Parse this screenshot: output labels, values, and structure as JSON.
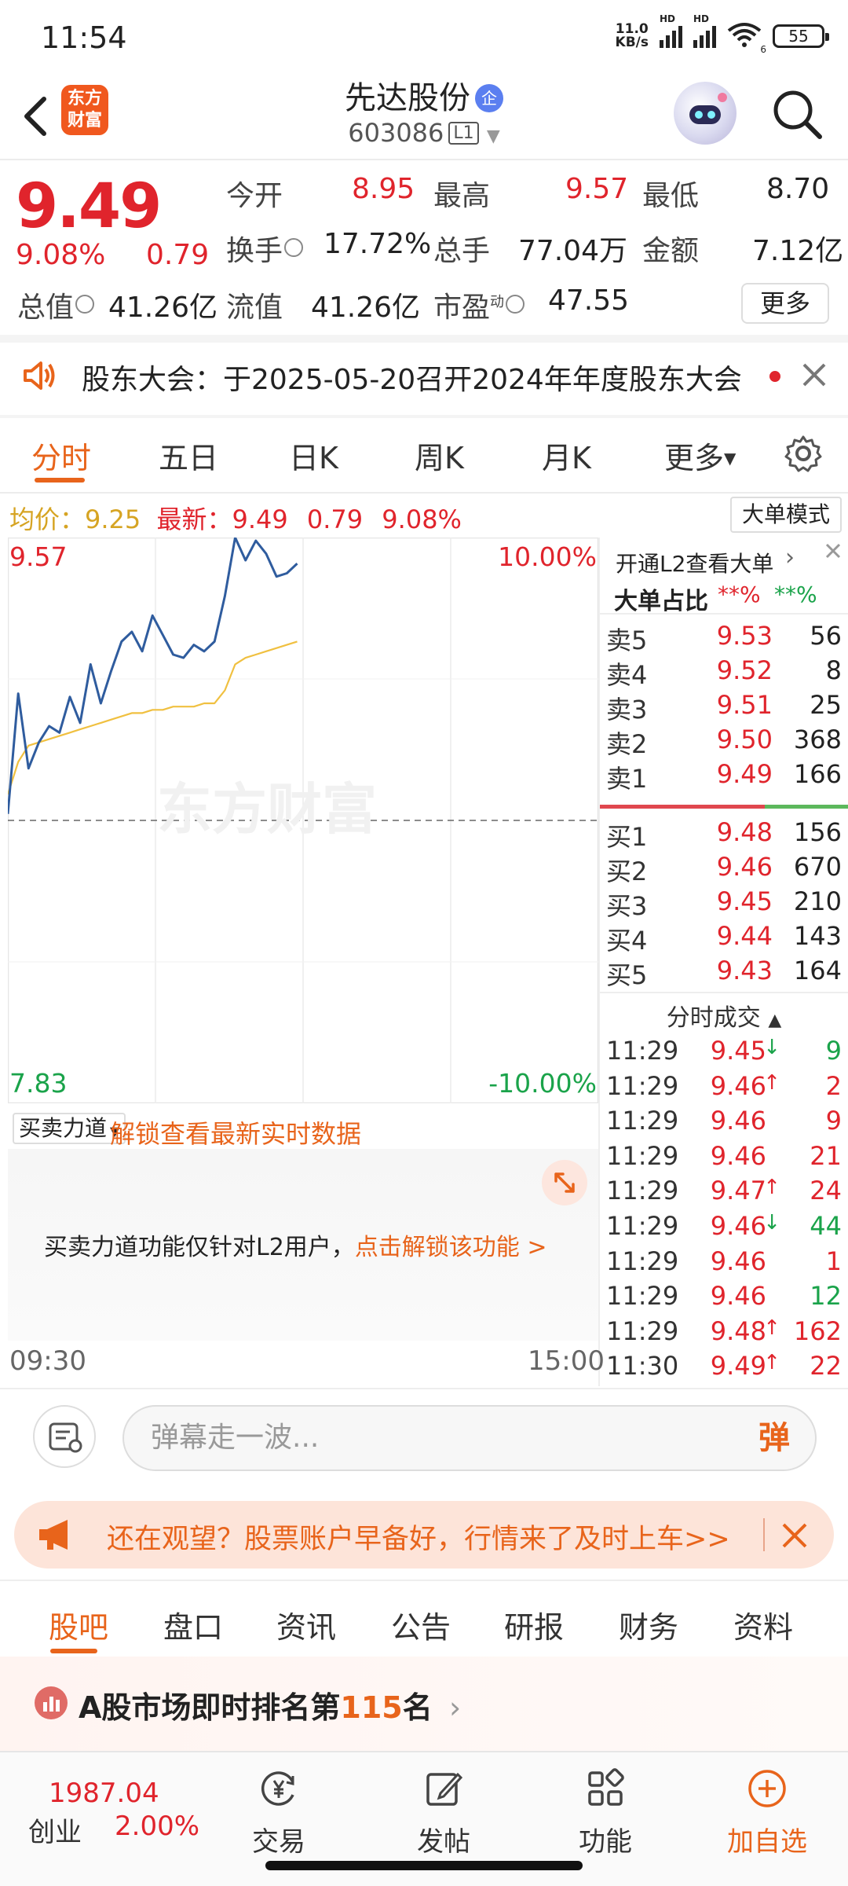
{
  "status_bar": {
    "time": "11:54",
    "net_speed_top": "11.0",
    "net_speed_bottom": "KB/s",
    "hd1": "HD",
    "hd2": "HD",
    "wifi_num": "6",
    "battery": "55"
  },
  "header": {
    "stock_name": "先达股份",
    "qi_badge": "企",
    "stock_code": "603086",
    "level_badge": "L1",
    "logo_line1": "东方",
    "logo_line2": "财富"
  },
  "quote": {
    "price": "9.49",
    "change_pct": "9.08%",
    "change": "0.79",
    "open_label": "今开",
    "open": "8.95",
    "high_label": "最高",
    "high": "9.57",
    "low_label": "最低",
    "low": "8.70",
    "turnover_label": "换手",
    "turnover": "17.72%",
    "volume_label": "总手",
    "volume": "77.04万",
    "amount_label": "金额",
    "amount": "7.12亿",
    "cap_label": "总值",
    "cap": "41.26亿",
    "float_label": "流值",
    "float_cap": "41.26亿",
    "pe_label": "市盈",
    "pe_sup": "动",
    "pe": "47.55",
    "more": "更多"
  },
  "notice": {
    "text": "股东大会：于2025-05-20召开2024年年度股东大会"
  },
  "chart_tabs": [
    "分时",
    "五日",
    "日K",
    "周K",
    "月K",
    "更多"
  ],
  "avg_line": {
    "avg_label": "均价：",
    "avg": "9.25",
    "latest_label": "最新：",
    "latest": "9.49",
    "chg": "0.79",
    "pct": "9.08%",
    "big_order_mode": "大单模式"
  },
  "chart_labels": {
    "top_price": "9.57",
    "top_pct": "10.00%",
    "bottom_price": "7.83",
    "bottom_pct": "-10.00%",
    "watermark": "东方财富",
    "start_time": "09:30",
    "end_time": "15:00"
  },
  "chart_data": {
    "type": "line",
    "x_range": [
      "09:30",
      "15:00"
    ],
    "ylim": [
      7.83,
      9.57
    ],
    "y_pct_range": [
      "-10.00%",
      "10.00%"
    ],
    "prev_close": 8.7,
    "series": [
      {
        "name": "价格",
        "color": "#2f5c9e",
        "values": [
          8.72,
          9.09,
          8.86,
          8.94,
          8.99,
          8.97,
          9.08,
          9.0,
          9.18,
          9.06,
          9.16,
          9.25,
          9.28,
          9.22,
          9.33,
          9.27,
          9.21,
          9.2,
          9.24,
          9.22,
          9.25,
          9.39,
          9.57,
          9.5,
          9.56,
          9.52,
          9.45,
          9.46,
          9.49
        ]
      },
      {
        "name": "均价",
        "color": "#f0c040",
        "values": [
          8.78,
          8.88,
          8.93,
          8.94,
          8.95,
          8.96,
          8.97,
          8.98,
          8.99,
          9.0,
          9.01,
          9.02,
          9.03,
          9.03,
          9.04,
          9.04,
          9.05,
          9.05,
          9.05,
          9.06,
          9.06,
          9.1,
          9.18,
          9.2,
          9.21,
          9.22,
          9.23,
          9.24,
          9.25
        ]
      }
    ]
  },
  "l2_promo": "开通L2查看大单",
  "big_order_ratio": {
    "label": "大单占比",
    "sell": "**%",
    "buy": "**%"
  },
  "sell_orders": [
    {
      "label": "卖5",
      "price": "9.53",
      "vol": "56"
    },
    {
      "label": "卖4",
      "price": "9.52",
      "vol": "8"
    },
    {
      "label": "卖3",
      "price": "9.51",
      "vol": "25"
    },
    {
      "label": "卖2",
      "price": "9.50",
      "vol": "368"
    },
    {
      "label": "卖1",
      "price": "9.49",
      "vol": "166"
    }
  ],
  "buy_orders": [
    {
      "label": "买1",
      "price": "9.48",
      "vol": "156"
    },
    {
      "label": "买2",
      "price": "9.46",
      "vol": "670"
    },
    {
      "label": "买3",
      "price": "9.45",
      "vol": "210"
    },
    {
      "label": "买4",
      "price": "9.44",
      "vol": "143"
    },
    {
      "label": "买5",
      "price": "9.43",
      "vol": "164"
    }
  ],
  "trades_title": "分时成交",
  "trades": [
    {
      "time": "11:29",
      "price": "9.45",
      "dir": "↓",
      "vol": "9",
      "vol_color": "green"
    },
    {
      "time": "11:29",
      "price": "9.46",
      "dir": "↑",
      "vol": "2",
      "vol_color": "red"
    },
    {
      "time": "11:29",
      "price": "9.46",
      "dir": "",
      "vol": "9",
      "vol_color": "red"
    },
    {
      "time": "11:29",
      "price": "9.46",
      "dir": "",
      "vol": "21",
      "vol_color": "red"
    },
    {
      "time": "11:29",
      "price": "9.47",
      "dir": "↑",
      "vol": "24",
      "vol_color": "red"
    },
    {
      "time": "11:29",
      "price": "9.46",
      "dir": "↓",
      "vol": "44",
      "vol_color": "green"
    },
    {
      "time": "11:29",
      "price": "9.46",
      "dir": "",
      "vol": "1",
      "vol_color": "red"
    },
    {
      "time": "11:29",
      "price": "9.46",
      "dir": "",
      "vol": "12",
      "vol_color": "green"
    },
    {
      "time": "11:29",
      "price": "9.48",
      "dir": "↑",
      "vol": "162",
      "vol_color": "red"
    },
    {
      "time": "11:30",
      "price": "9.49",
      "dir": "↑",
      "vol": "22",
      "vol_color": "red"
    }
  ],
  "power": {
    "select": "买卖力道",
    "unlock": "解锁查看最新实时数据",
    "msg_prefix": "买卖力道功能仅针对L2用户，",
    "msg_link": "点击解锁该功能 >"
  },
  "comment": {
    "placeholder": "弹幕走一波...",
    "danmu": "弹"
  },
  "promo": {
    "text": "还在观望？股票账户早备好，行情来了及时上车>>"
  },
  "section_tabs": [
    "股吧",
    "盘口",
    "资讯",
    "公告",
    "研报",
    "财务",
    "资料"
  ],
  "ranking": {
    "prefix": "A股市场即时排名第",
    "rank": "115",
    "suffix": "名"
  },
  "bottom_nav": {
    "index_value": "1987.04",
    "index_name": "创业",
    "index_pct": "2.00%",
    "items": [
      "交易",
      "发帖",
      "功能",
      "加自选"
    ]
  },
  "colors": {
    "up": "#e0242c",
    "down": "#1aa34a",
    "accent": "#e8641b",
    "price_line": "#2f5c9e",
    "avg_line": "#f0c040"
  }
}
